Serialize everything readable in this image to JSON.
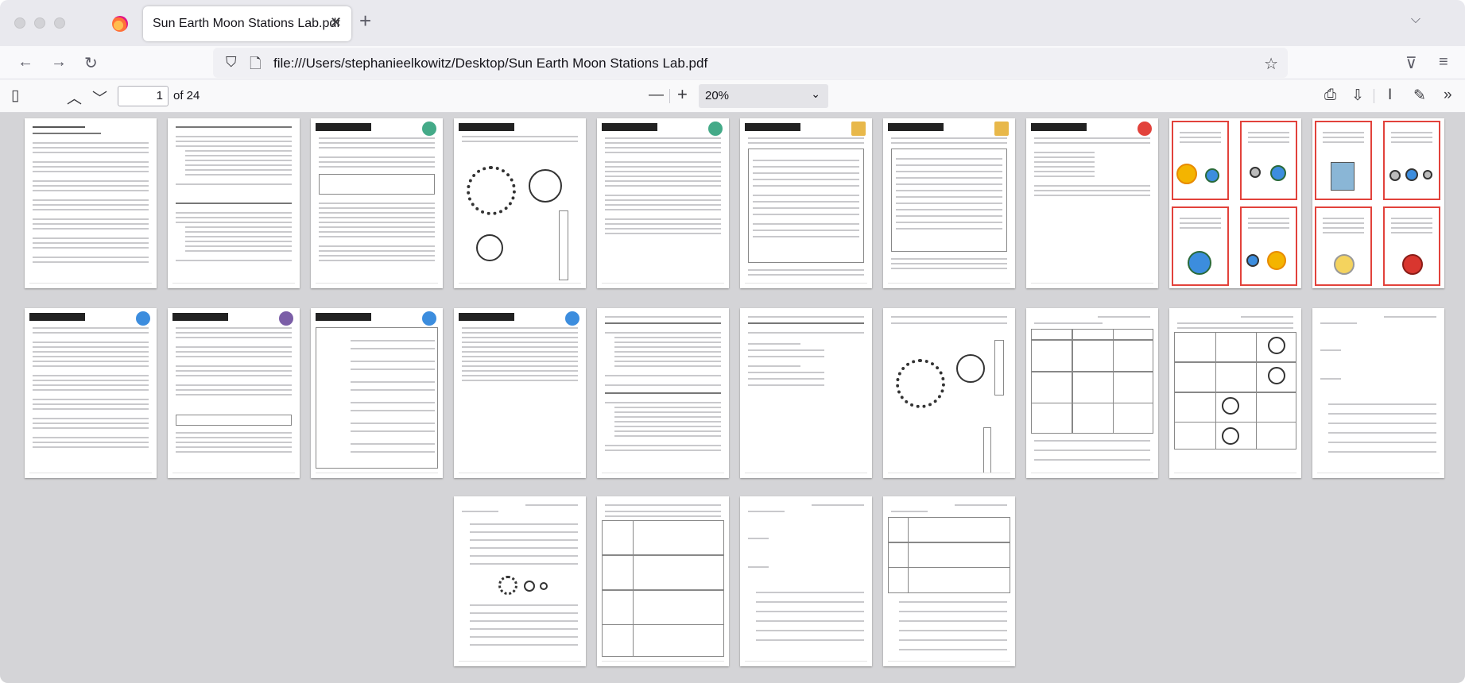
{
  "browser": {
    "tab_title": "Sun Earth Moon Stations Lab.pdf",
    "tab_close": "✕",
    "new_tab": "+",
    "tabs_menu": "⌵",
    "url": "file:///Users/stephanieelkowitz/Desktop/Sun Earth Moon Stations Lab.pdf"
  },
  "icons": {
    "back": "←",
    "forward": "→",
    "reload": "↻",
    "shield": "⛉",
    "page": "🗋",
    "star": "☆",
    "pocket": "⊽",
    "menu": "≡",
    "sidebar": "▯",
    "prev": "︿",
    "next": "﹀",
    "zoom_out": "—",
    "zoom_in": "+",
    "print": "⎙",
    "save": "⇩",
    "text": "I",
    "draw": "✎",
    "more": "»"
  },
  "pdf": {
    "current_page": "1",
    "page_count": "of 24",
    "zoom": "20%",
    "zoom_chevron": "⌄"
  },
  "colors": {
    "accent_red": "#e2423b",
    "viewer_bg": "#d4d4d7"
  }
}
